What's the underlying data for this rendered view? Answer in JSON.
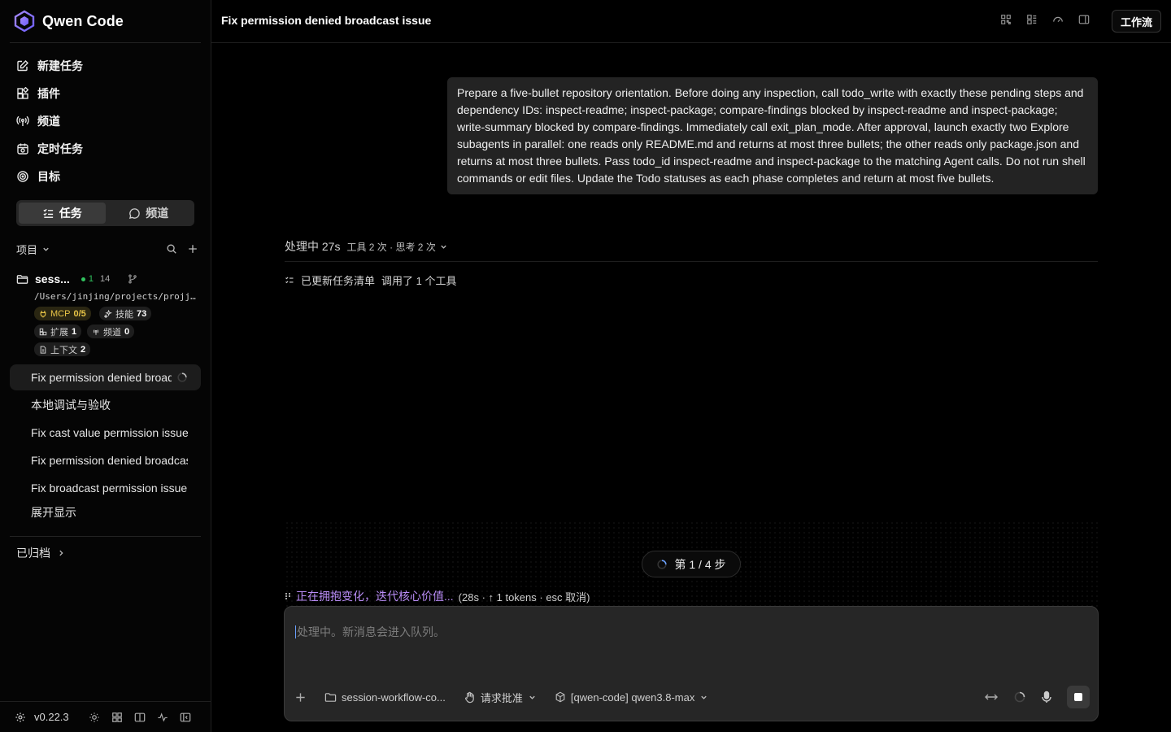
{
  "app": {
    "name": "Qwen Code"
  },
  "nav": [
    {
      "id": "new-task",
      "label": "新建任务",
      "icon": "edit-icon"
    },
    {
      "id": "plugins",
      "label": "插件",
      "icon": "plugin-icon"
    },
    {
      "id": "channels",
      "label": "频道",
      "icon": "broadcast-icon"
    },
    {
      "id": "scheduled",
      "label": "定时任务",
      "icon": "clock-icon"
    },
    {
      "id": "goals",
      "label": "目标",
      "icon": "target-icon"
    }
  ],
  "segment": {
    "tasks": "任务",
    "channels": "频道",
    "active": "tasks"
  },
  "projects": {
    "header": "项目"
  },
  "project": {
    "name": "sess...",
    "stat_green": "1",
    "stat_count": "14",
    "path": "/Users/jinjing/projects/projj/…",
    "chips": {
      "mcp_label": "MCP",
      "mcp_value": "0/5",
      "skills_label": "技能",
      "skills_value": "73",
      "ext_label": "扩展",
      "ext_value": "1",
      "channel_label": "频道",
      "channel_value": "0",
      "context_label": "上下文",
      "context_value": "2"
    }
  },
  "sessions": [
    "Fix permission denied broadcast issue",
    "本地调试与验收",
    "Fix cast value permission issue",
    "Fix permission denied broadcast issue",
    "Fix broadcast permission issue"
  ],
  "expand_label": "展开显示",
  "archived_label": "已归档",
  "footer": {
    "version": "v0.22.3"
  },
  "topbar": {
    "title": "Fix permission denied broadcast issue",
    "workflow_button": "工作流"
  },
  "conversation": {
    "user_message": "Prepare a five-bullet repository orientation. Before doing any inspection, call todo_write with exactly these pending steps and dependency IDs: inspect-readme; inspect-package; compare-findings blocked by inspect-readme and inspect-package; write-summary blocked by compare-findings. Immediately call exit_plan_mode. After approval, launch exactly two Explore subagents in parallel: one reads only README.md and returns at most three bullets; the other reads only package.json and returns at most three bullets. Pass todo_id inspect-readme and inspect-package to the matching Agent calls. Do not run shell commands or edit files. Update the Todo statuses as each phase completes and return at most five bullets.",
    "status": "处理中 27s",
    "status_meta": "工具 2 次 · 思考 2 次",
    "todo_update": "已更新任务清单",
    "todo_tools": "调用了 1 个工具",
    "step": "第 1 / 4 步",
    "thinking_text": "正在拥抱变化，迭代核心价值...",
    "thinking_meta": "(28s · ↑ 1 tokens · esc 取消)"
  },
  "composer": {
    "placeholder": "处理中。新消息会进入队列。",
    "folder": "session-workflow-co...",
    "approval": "请求批准",
    "model": "[qwen-code] qwen3.8-max"
  },
  "colors": {
    "accent_purple": "#b98cf6",
    "mcp_yellow": "#e8c547",
    "online_green": "#31c35f"
  }
}
